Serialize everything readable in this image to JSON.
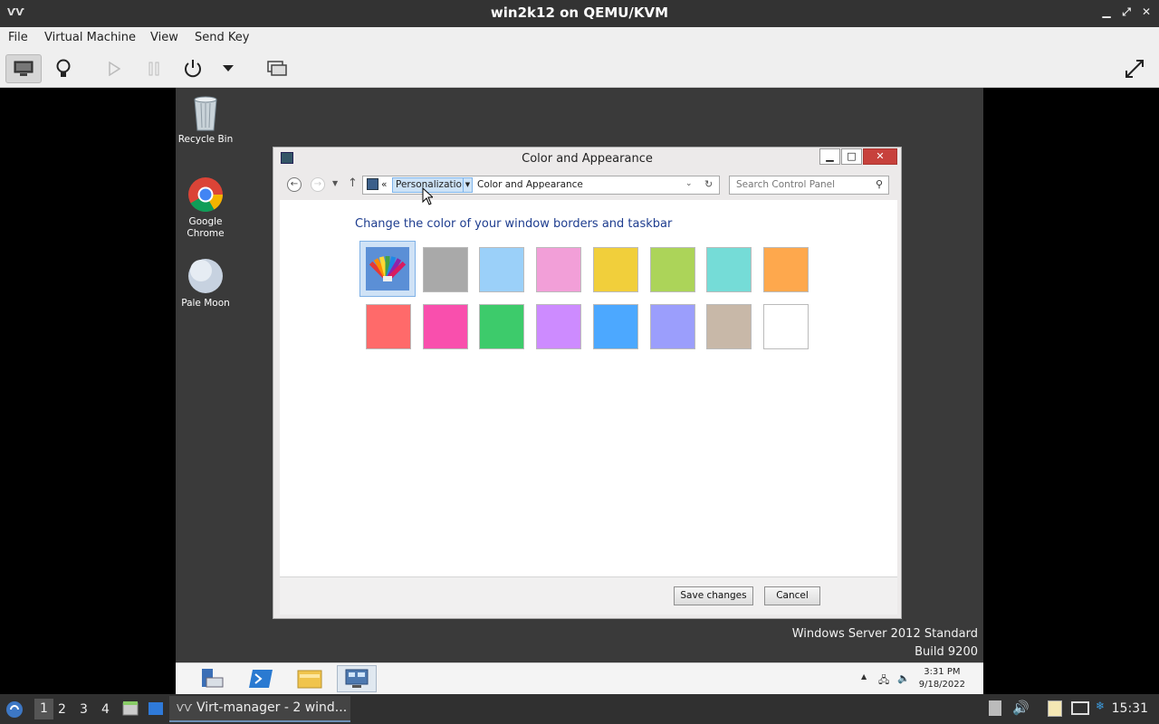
{
  "window": {
    "title": "win2k12 on QEMU/KVM",
    "app_icon": "virt-manager-icon"
  },
  "menubar": {
    "items": [
      "File",
      "Virtual Machine",
      "View",
      "Send Key"
    ]
  },
  "toolbar": {
    "icons": [
      "monitor-icon",
      "lightbulb-icon",
      "play-icon",
      "pause-icon",
      "power-icon",
      "dropdown-arrow-icon",
      "snapshots-icon",
      "fullscreen-icon"
    ]
  },
  "desktop": {
    "icons": [
      {
        "label": "Recycle Bin"
      },
      {
        "label": "Google Chrome"
      },
      {
        "label": "Pale Moon"
      }
    ],
    "watermark": {
      "line1": "Windows Server 2012 Standard",
      "line2": "Build 9200"
    }
  },
  "dialog": {
    "title": "Color and Appearance",
    "address": {
      "overflow": "«",
      "crumb1": "Personalization",
      "crumb2": "Color and Appearance"
    },
    "search_placeholder": "Search Control Panel",
    "heading": "Change the color of your window borders and taskbar",
    "swatches_row1": [
      "auto",
      "#a9a9a9",
      "#9bd0f9",
      "#f29fd8",
      "#f1cf3b",
      "#acd459",
      "#75dcd7",
      "#fea84d"
    ],
    "swatches_row2": [
      "#ff6a6a",
      "#f94fad",
      "#3dcb6b",
      "#cd8bff",
      "#4ca8ff",
      "#9b9efc",
      "#c8b8a8",
      "#ffffff"
    ],
    "buttons": {
      "save": "Save changes",
      "cancel": "Cancel"
    }
  },
  "win_taskbar": {
    "time": "3:31 PM",
    "date": "9/18/2022"
  },
  "host_panel": {
    "workspaces": [
      "1",
      "2",
      "3",
      "4"
    ],
    "task": "Virt-manager - 2 wind...",
    "clock": "15:31"
  }
}
